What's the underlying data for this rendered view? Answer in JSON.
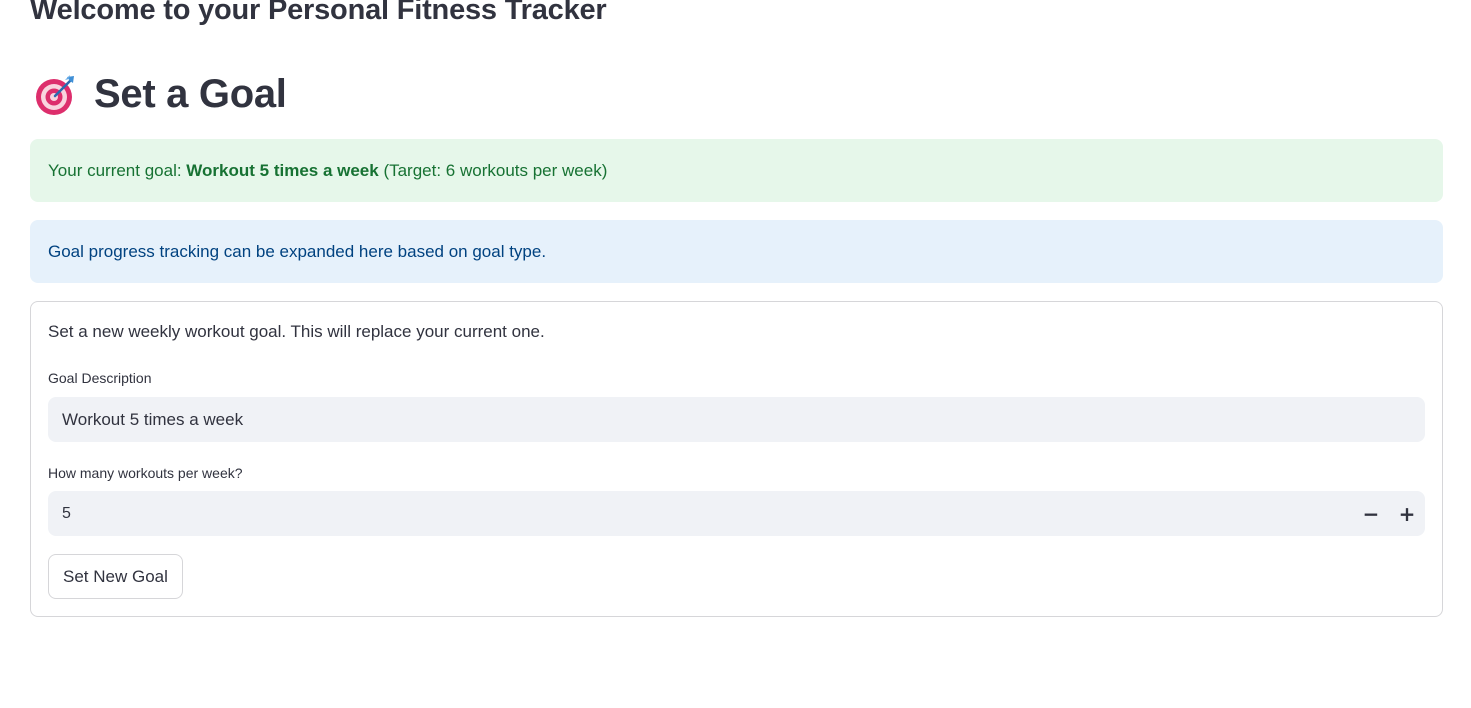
{
  "app": {
    "title": "Welcome to your Personal Fitness Tracker"
  },
  "goal_section": {
    "icon": "target-icon",
    "title": "Set a Goal"
  },
  "current_goal_alert": {
    "prefix": "Your current goal: ",
    "goal_text": "Workout 5 times a week",
    "suffix": " (Target: 6 workouts per week)",
    "color": "#177233",
    "background": "#e6f7ea"
  },
  "info_alert": {
    "text": "Goal progress tracking can be expanded here based on goal type.",
    "color": "#004280",
    "background": "#e6f1fb"
  },
  "form": {
    "intro": "Set a new weekly workout goal. This will replace your current one.",
    "description_label": "Goal Description",
    "description_value": "Workout 5 times a week",
    "count_label": "How many workouts per week?",
    "count_value": "5",
    "decrement_label": "−",
    "increment_label": "+",
    "submit_label": "Set New Goal"
  }
}
